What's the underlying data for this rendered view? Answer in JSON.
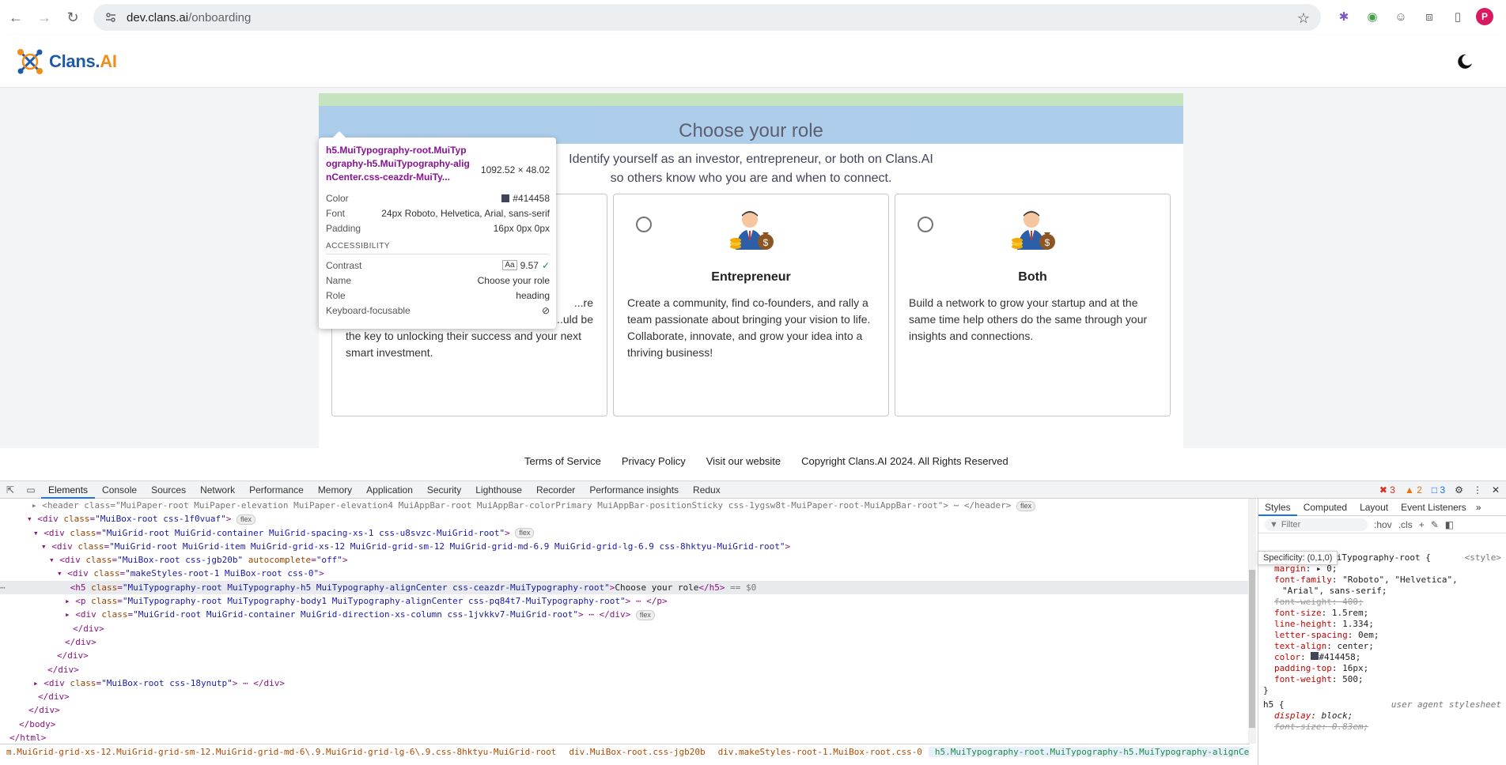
{
  "browser": {
    "url_host": "dev.clans.ai",
    "url_path": "/onboarding",
    "profile_initial": "P"
  },
  "header": {
    "logo_text_main": "Clans.",
    "logo_text_accent": "AI"
  },
  "onboarding": {
    "title": "Choose your role",
    "subtitle_line1": "Identify yourself as an investor, entrepreneur, or both on Clans.AI",
    "subtitle_line2": "so others know who you are and when to connect.",
    "cards": [
      {
        "title": "",
        "desc_line1": "...re",
        "desc_line2": "...uld be",
        "desc_line3": "the key to unlocking their success and your next",
        "desc_line4": "smart investment."
      },
      {
        "title": "Entrepreneur",
        "desc": "Create a community, find co-founders, and rally a team passionate about bringing your vision to life. Collaborate, innovate, and grow your idea into a thriving business!"
      },
      {
        "title": "Both",
        "desc": "Build a network to grow your startup and at the same time help others do the same through your insights and connections."
      }
    ]
  },
  "footer": {
    "links": [
      "Terms of Service",
      "Privacy Policy",
      "Visit our website",
      "Copyright Clans.AI 2024. All Rights Reserved"
    ]
  },
  "inspect_tooltip": {
    "selector": "h5.MuiTypography-root.MuiTypography-h5.MuiTypography-alignCenter.css-ceazdr-MuiTy...",
    "dimensions": "1092.52 × 48.02",
    "color_label": "Color",
    "color_value": "#414458",
    "font_label": "Font",
    "font_value": "24px Roboto, Helvetica, Arial, sans-serif",
    "padding_label": "Padding",
    "padding_value": "16px 0px 0px",
    "accessibility_label": "ACCESSIBILITY",
    "contrast_label": "Contrast",
    "contrast_value": "9.57",
    "name_label": "Name",
    "name_value": "Choose your role",
    "role_label": "Role",
    "role_value": "heading",
    "kbd_label": "Keyboard-focusable"
  },
  "devtools": {
    "tabs": [
      "Elements",
      "Console",
      "Sources",
      "Network",
      "Performance",
      "Memory",
      "Application",
      "Security",
      "Lighthouse",
      "Recorder",
      "Performance insights",
      "Redux"
    ],
    "errors": "3",
    "warnings": "2",
    "infos": "3",
    "styles_tabs": [
      "Styles",
      "Computed",
      "Layout",
      "Event Listeners"
    ],
    "filter_placeholder": "Filter",
    "hov": ":hov",
    "cls": ".cls",
    "specificity_tip": "Specificity: (0,1,0)",
    "breadcrumbs": [
      "m.MuiGrid-grid-xs-12.MuiGrid-grid-sm-12.MuiGrid-grid-md-6\\.9.MuiGrid-grid-lg-6\\.9.css-8hktyu-MuiGrid-root",
      "div.MuiBox-root.css-jgb20b",
      "div.makeStyles-root-1.MuiBox-root.css-0",
      "h5.MuiTypography-root.MuiTypography-h5.MuiTypography-alignCenter.css-ceazdr-MuiTypography-root"
    ]
  }
}
